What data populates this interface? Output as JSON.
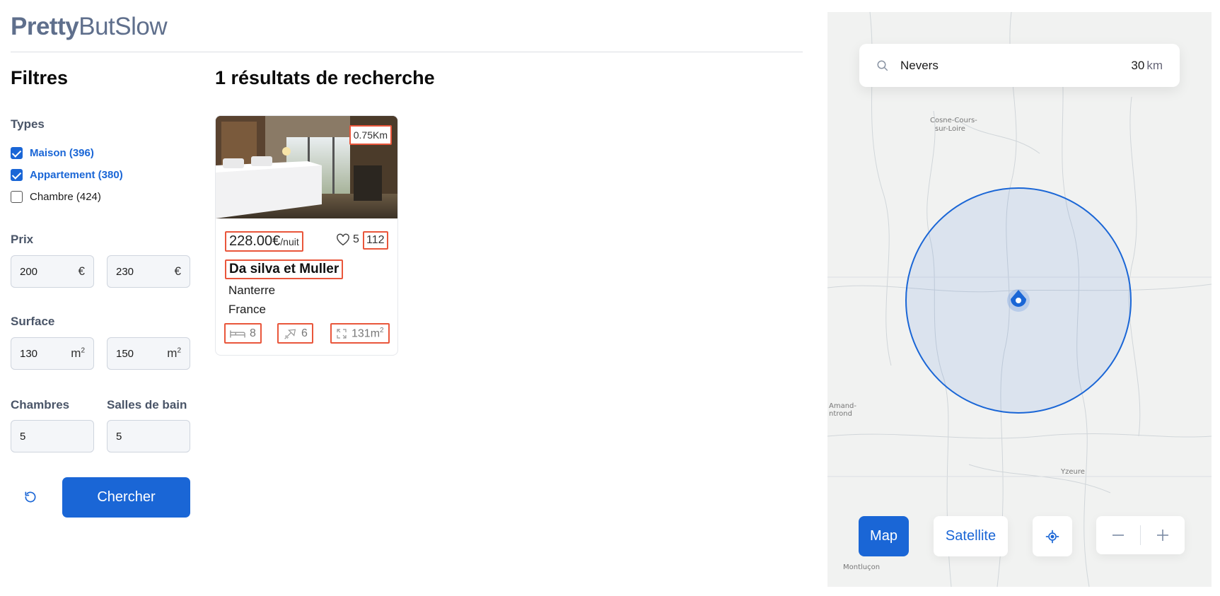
{
  "brand": {
    "bold": "Pretty",
    "light": "ButSlow"
  },
  "filters": {
    "title": "Filtres",
    "types_label": "Types",
    "types": [
      {
        "label": "Maison (396)",
        "checked": true
      },
      {
        "label": "Appartement (380)",
        "checked": true
      },
      {
        "label": "Chambre (424)",
        "checked": false
      }
    ],
    "price_label": "Prix",
    "price_min": "200",
    "price_max": "230",
    "currency": "€",
    "surface_label": "Surface",
    "surface_min": "130",
    "surface_max": "150",
    "surface_unit": "m",
    "surface_unit_exp": "2",
    "bedrooms_label": "Chambres",
    "bedrooms": "5",
    "bathrooms_label": "Salles de bain",
    "bathrooms": "5",
    "search_label": "Chercher"
  },
  "results": {
    "title": "1 résultats de recherche",
    "cards": [
      {
        "distance": "0.75Km",
        "price": "228.00€",
        "price_unit": "/nuit",
        "likes": "5",
        "rating": "112",
        "name": "Da silva et Muller",
        "city": "Nanterre",
        "country": "France",
        "beds": "8",
        "bathrooms": "6",
        "surface": "131m",
        "surface_exp": "2"
      }
    ]
  },
  "map": {
    "query": "Nevers",
    "radius_value": "30",
    "radius_unit": "km",
    "buttons": {
      "map": "Map",
      "satellite": "Satellite"
    },
    "place_labels": [
      "Cosne-Cours-",
      "sur-Loire",
      "Amand-",
      "ntrond",
      "Yzeure",
      "Montluçon"
    ],
    "accent": "#1a66d6"
  },
  "colors": {
    "accent": "#1a66d6",
    "highlight_box": "#e9563b",
    "brand": "#5f6f8c"
  }
}
